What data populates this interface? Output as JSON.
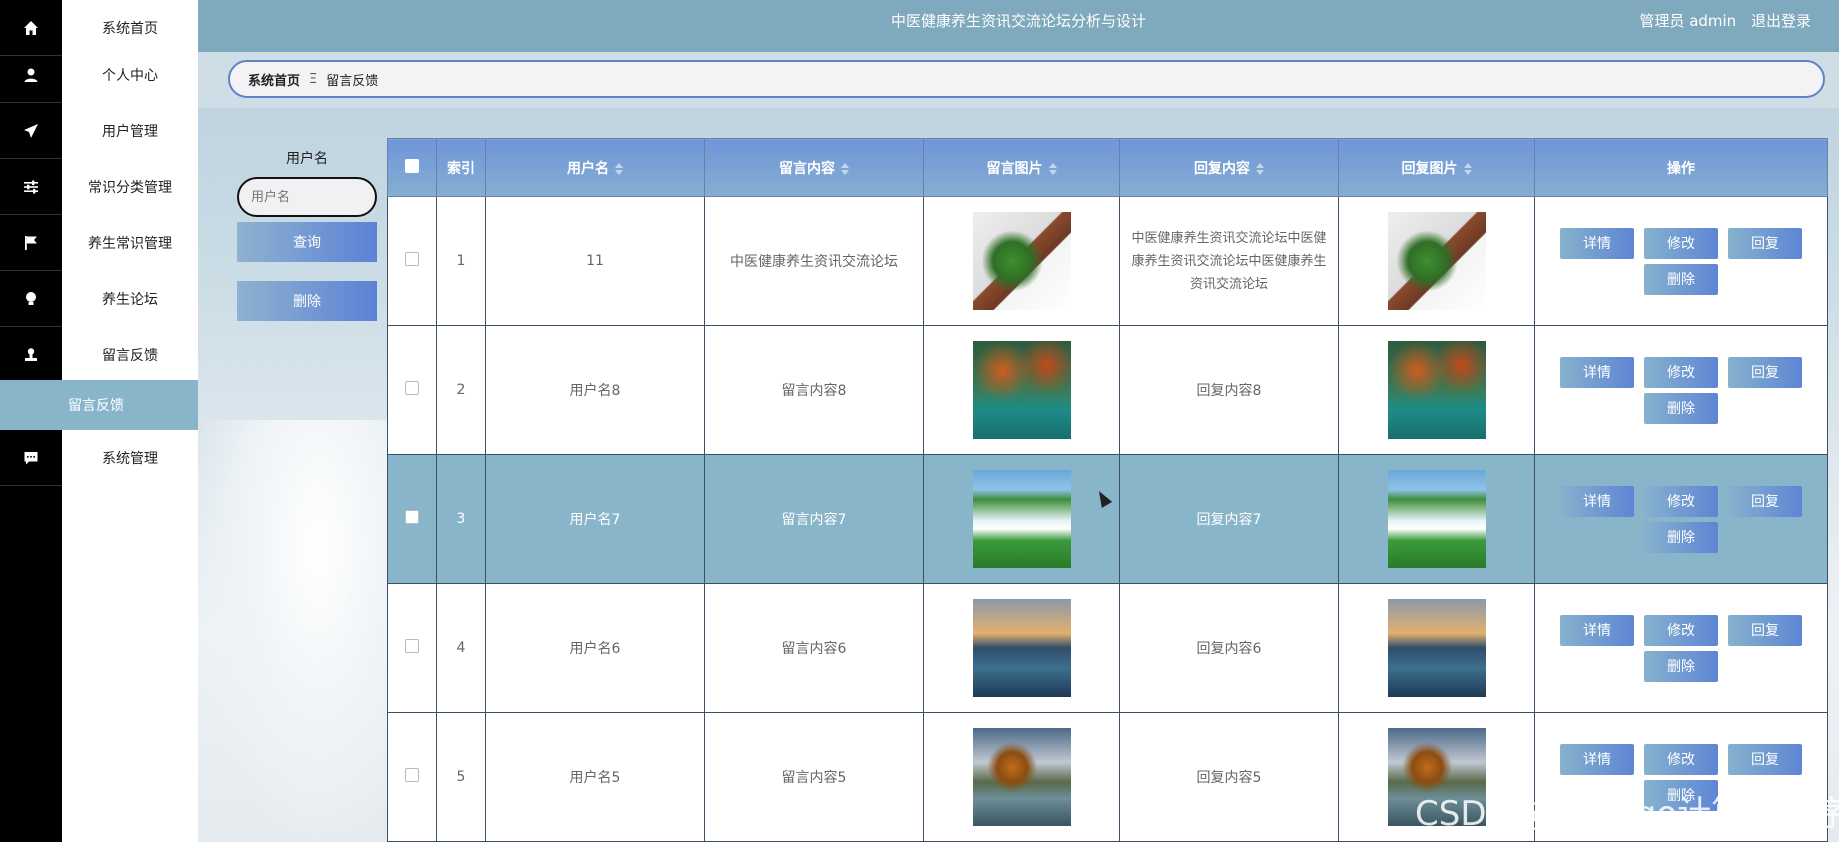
{
  "header": {
    "title": "中医健康养生资讯交流论坛分析与设计",
    "user_label": "管理员 admin",
    "logout": "退出登录"
  },
  "sidebar": {
    "items": [
      {
        "label": "系统首页",
        "icon": "home-icon"
      },
      {
        "label": "个人中心",
        "icon": "user-icon"
      },
      {
        "label": "用户管理",
        "icon": "send-icon"
      },
      {
        "label": "常识分类管理",
        "icon": "sliders-icon"
      },
      {
        "label": "养生常识管理",
        "icon": "flag-icon"
      },
      {
        "label": "养生论坛",
        "icon": "bulb-icon"
      },
      {
        "label": "留言反馈",
        "icon": "stamp-icon"
      },
      {
        "label": "系统管理",
        "icon": "chat-icon"
      }
    ],
    "active_sub": "留言反馈"
  },
  "breadcrumb": {
    "root": "系统首页",
    "separator": "Ξ",
    "current": "留言反馈"
  },
  "search": {
    "label": "用户名",
    "placeholder": "用户名",
    "query_button": "查询",
    "delete_button": "删除"
  },
  "table": {
    "columns": [
      "索引",
      "用户名",
      "留言内容",
      "留言图片",
      "回复内容",
      "回复图片",
      "操作"
    ],
    "rows": [
      {
        "index": "1",
        "username": "11",
        "content": "中医健康养生资讯交流论坛",
        "reply": "中医健康养生资讯交流论坛中医健康养生资讯交流论坛中医健康养生资讯交流论坛",
        "image": "plant"
      },
      {
        "index": "2",
        "username": "用户名8",
        "content": "留言内容8",
        "reply": "回复内容8",
        "image": "autumn"
      },
      {
        "index": "3",
        "username": "用户名7",
        "content": "留言内容7",
        "reply": "回复内容7",
        "image": "falls"
      },
      {
        "index": "4",
        "username": "用户名6",
        "content": "留言内容6",
        "reply": "回复内容6",
        "image": "sunset"
      },
      {
        "index": "5",
        "username": "用户名5",
        "content": "留言内容5",
        "reply": "回复内容5",
        "image": "lake"
      }
    ],
    "actions": [
      "详情",
      "修改",
      "回复",
      "删除"
    ],
    "highlighted_row": 3
  },
  "watermark": "CSDN @Django计算机程序",
  "colors": {
    "accent": "#5b82d6",
    "header": "#7fa9bd",
    "highlight": "#88b5c9"
  }
}
